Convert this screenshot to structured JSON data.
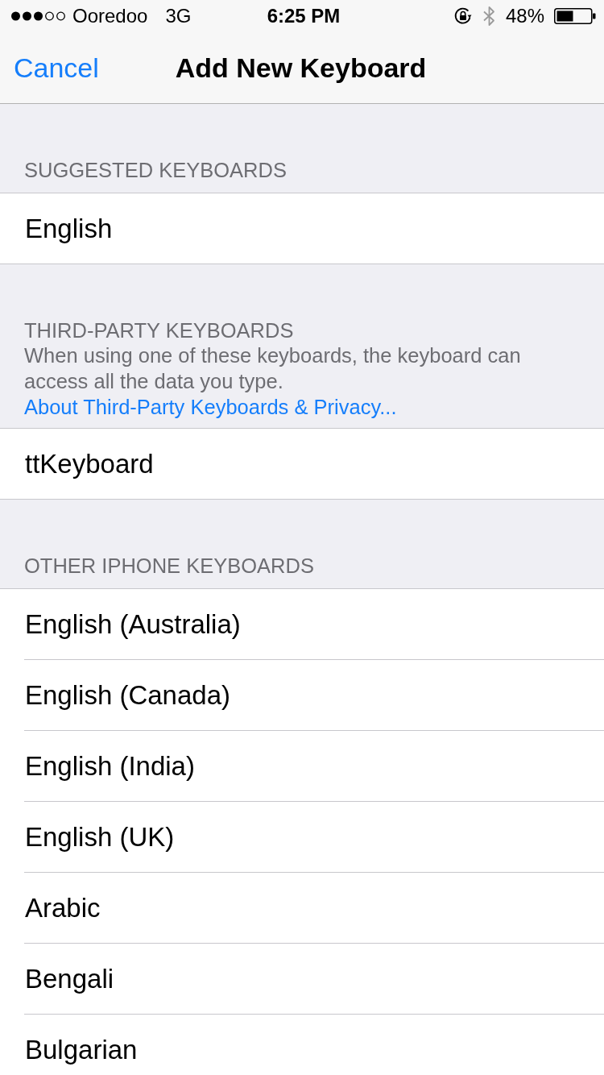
{
  "status_bar": {
    "carrier": "Ooredoo",
    "network": "3G",
    "time": "6:25 PM",
    "battery": "48%"
  },
  "nav_bar": {
    "left_button": "Cancel",
    "title": "Add New Keyboard"
  },
  "sections": [
    {
      "header": "SUGGESTED KEYBOARDS",
      "rows": [
        {
          "label": "English"
        }
      ]
    },
    {
      "header": "THIRD-PARTY KEYBOARDS",
      "footer_text": "When using one of these keyboards, the keyboard can access all the data you type.",
      "footer_link": "About Third-Party Keyboards & Privacy...",
      "rows": [
        {
          "label": "ttKeyboard"
        }
      ]
    },
    {
      "header": "OTHER IPHONE KEYBOARDS",
      "rows": [
        {
          "label": "English (Australia)"
        },
        {
          "label": "English (Canada)"
        },
        {
          "label": "English (India)"
        },
        {
          "label": "English (UK)"
        },
        {
          "label": "Arabic"
        },
        {
          "label": "Bengali"
        },
        {
          "label": "Bulgarian"
        }
      ]
    }
  ]
}
